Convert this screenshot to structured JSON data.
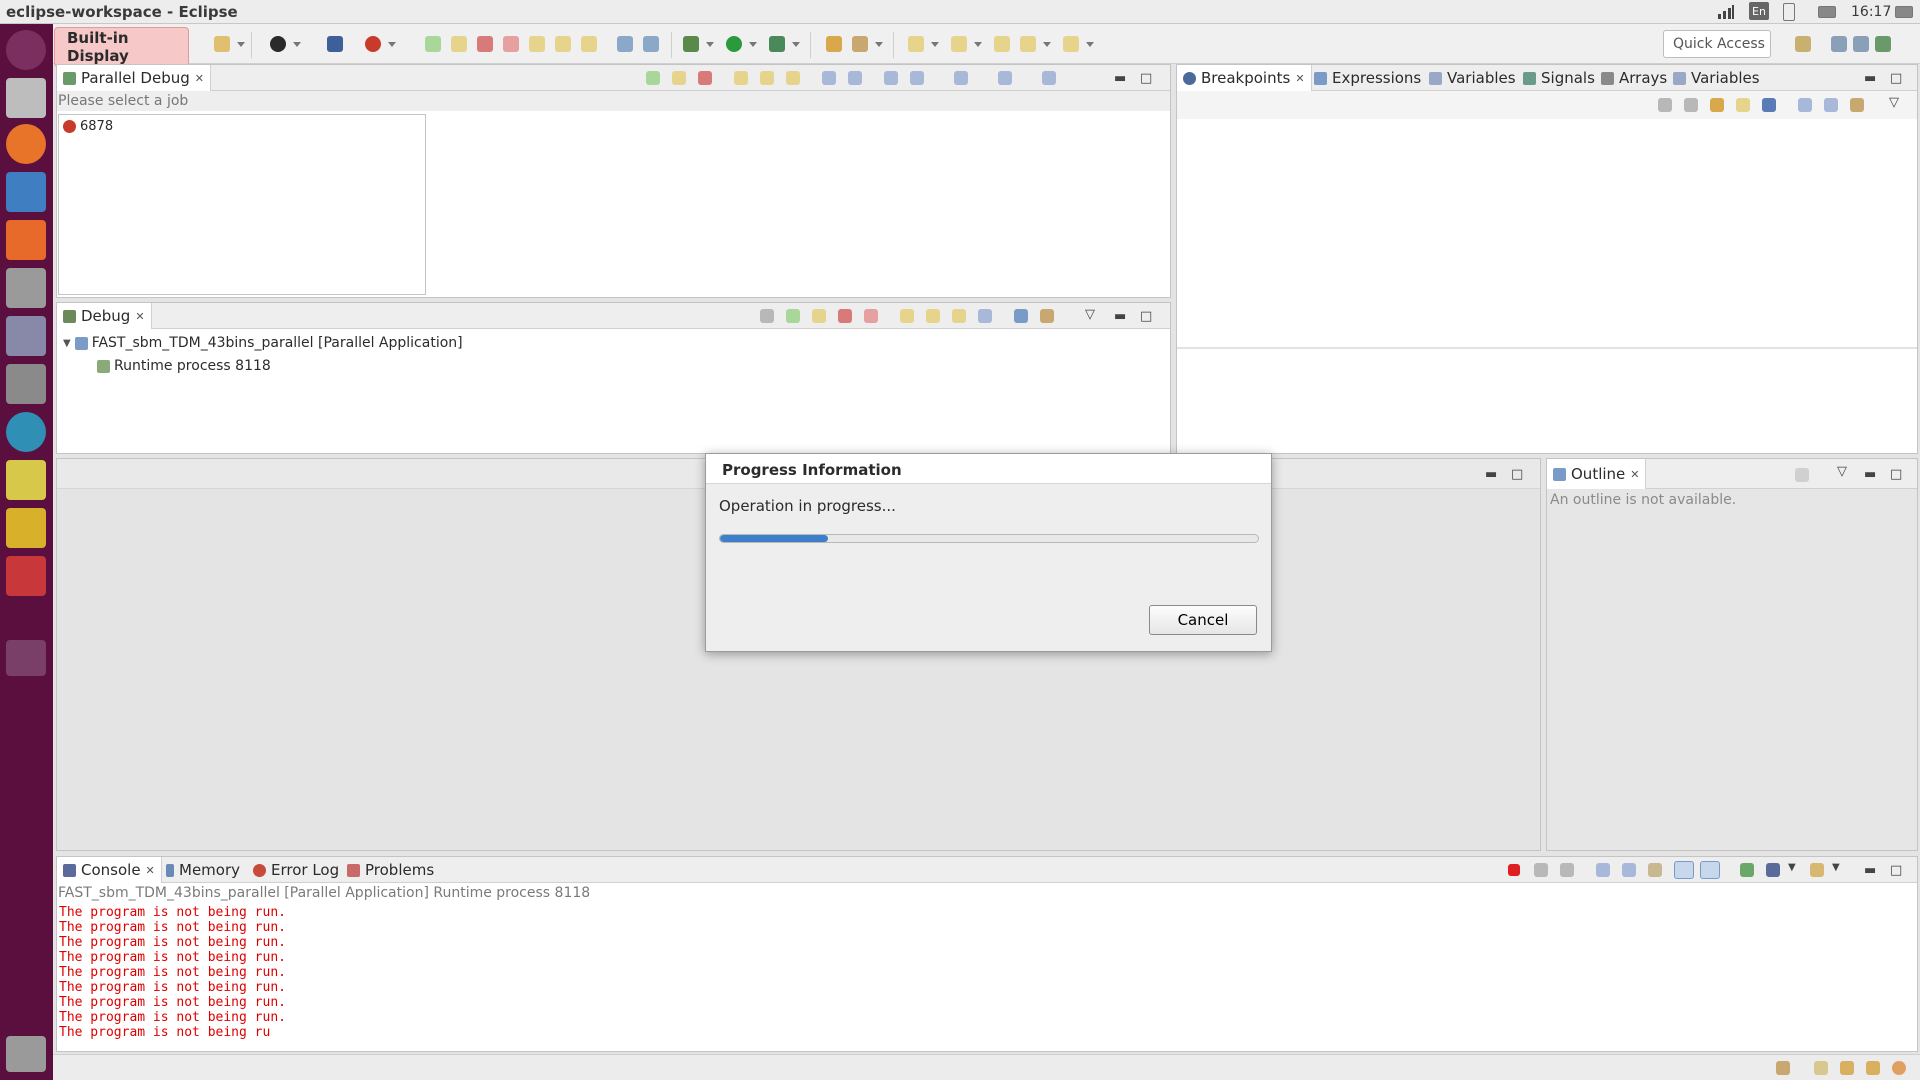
{
  "window": {
    "title": "eclipse-workspace - Eclipse"
  },
  "tray": {
    "keyboard": "En",
    "clock": "16:17"
  },
  "toolbar": {
    "builtin_label": "Built-in Display",
    "quick_access": "Quick Access"
  },
  "parallel_debug": {
    "tab": "Parallel Debug",
    "hint": "Please select a job",
    "job": "6878"
  },
  "debug": {
    "tab": "Debug",
    "app": "FAST_sbm_TDM_43bins_parallel [Parallel Application]",
    "process": "Runtime process 8118"
  },
  "right_tabs": [
    "Breakpoints",
    "Expressions",
    "Variables",
    "Signals",
    "Arrays",
    "Variables"
  ],
  "outline": {
    "tab": "Outline",
    "message": "An outline is not available."
  },
  "dialog": {
    "title": "Progress Information",
    "message": "Operation in progress...",
    "progress": 0.2,
    "cancel": "Cancel"
  },
  "bottom_tabs": [
    "Console",
    "Memory",
    "Error Log",
    "Problems"
  ],
  "console": {
    "header": "FAST_sbm_TDM_43bins_parallel [Parallel Application] Runtime process 8118",
    "lines": [
      "The program is not being run.",
      "The program is not being run.",
      "The program is not being run.",
      "The program is not being run.",
      "The program is not being run.",
      "The program is not being run.",
      "The program is not being run.",
      "The program is not being run.",
      "The program is not being ru"
    ]
  },
  "colors": {
    "launcher": "#5a0f3f",
    "accent": "#3d7fc9",
    "error_text": "#e00000"
  }
}
